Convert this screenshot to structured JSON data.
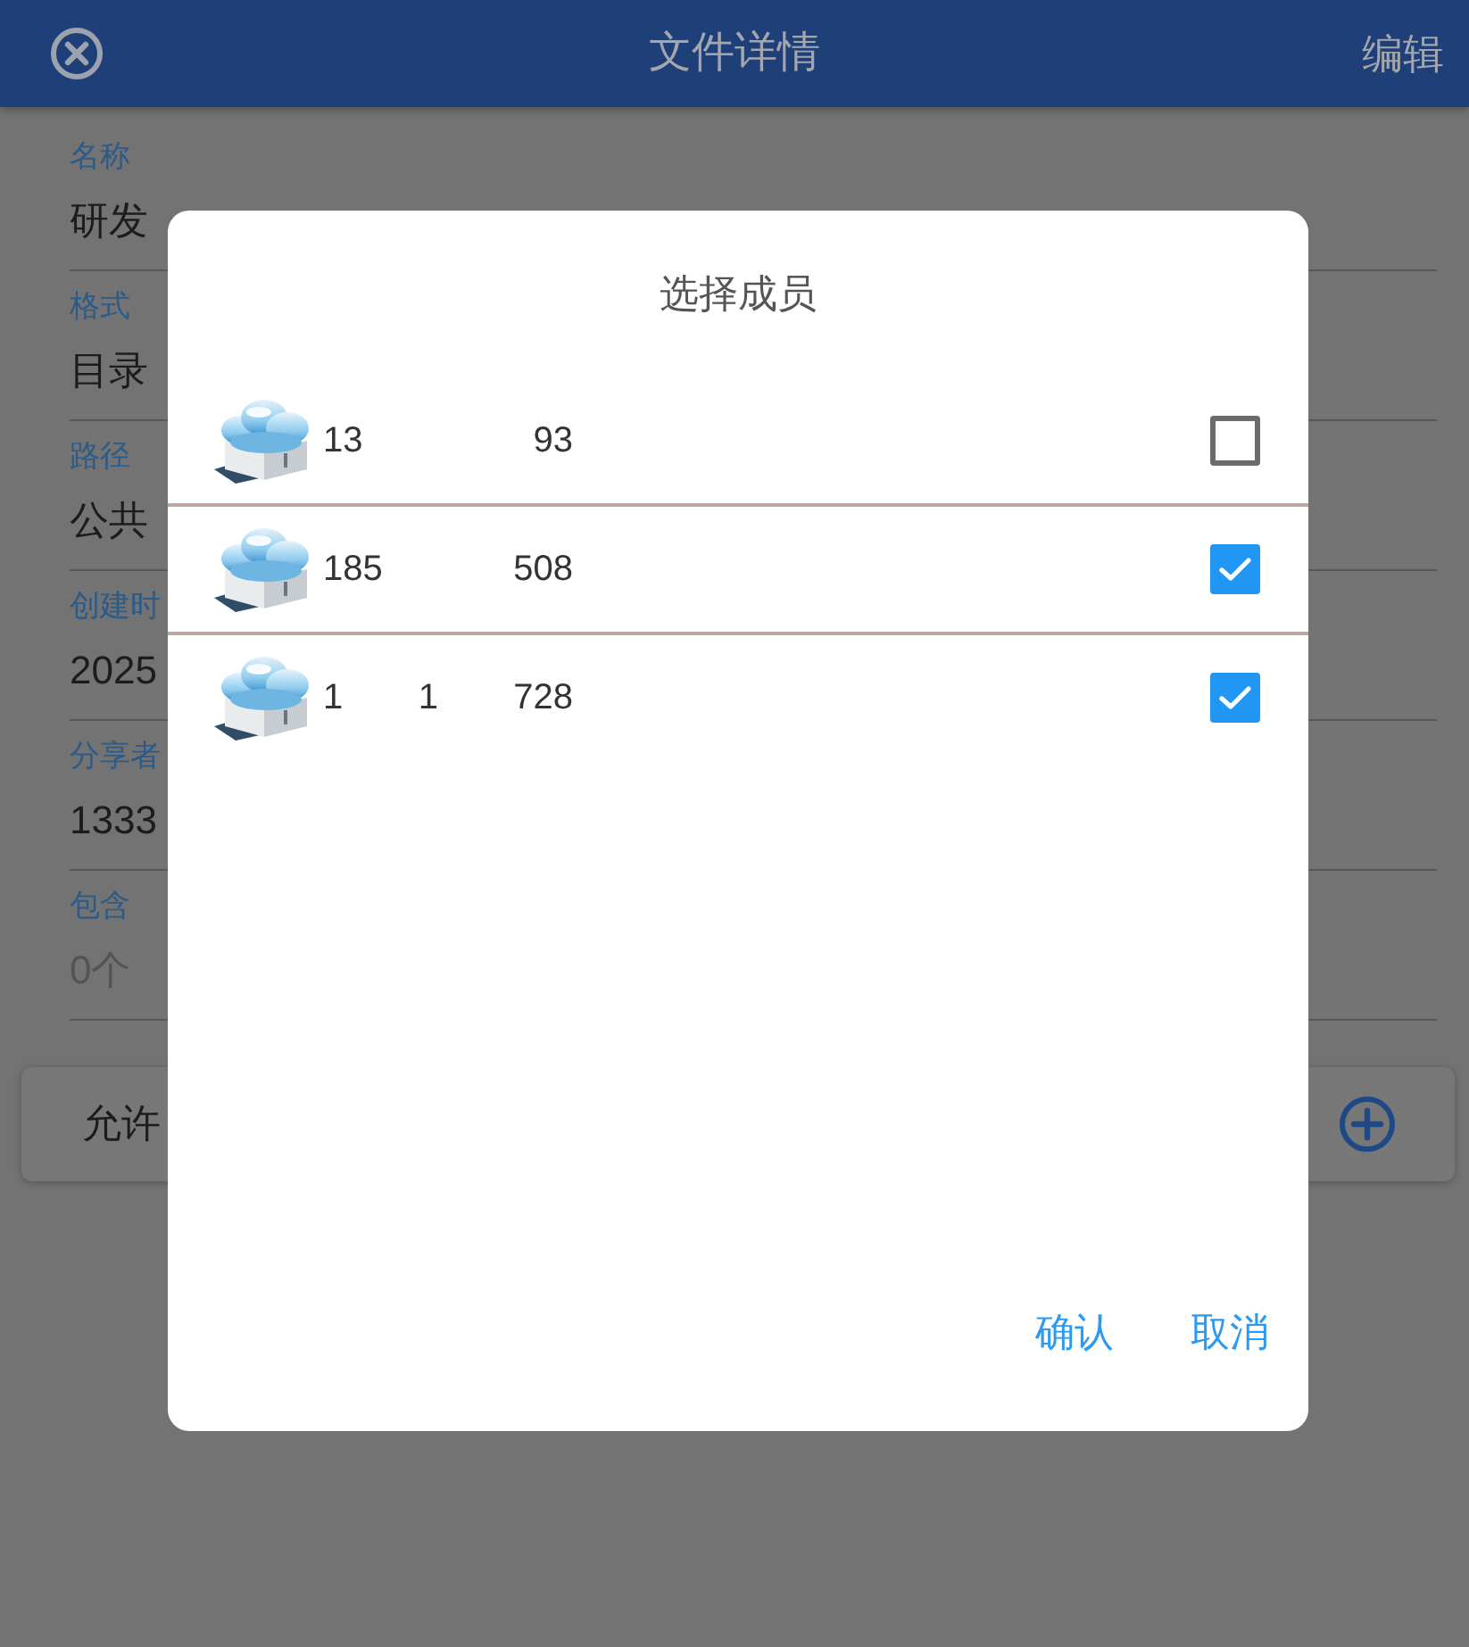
{
  "header": {
    "title": "文件详情",
    "action": "编辑"
  },
  "fields": [
    {
      "label": "名称",
      "value": "研发",
      "muted": false
    },
    {
      "label": "格式",
      "value": "目录",
      "muted": false
    },
    {
      "label": "路径",
      "value": "公共",
      "muted": false
    },
    {
      "label": "创建时",
      "value": "2025",
      "muted": false
    },
    {
      "label": "分享者",
      "value": "1333",
      "muted": false
    },
    {
      "label": "包含",
      "value": "0个",
      "muted": true
    }
  ],
  "permission_card": {
    "label": "允许"
  },
  "dialog": {
    "title": "选择成员",
    "members": [
      {
        "name_parts": [
          "13",
          "93"
        ],
        "checked": false
      },
      {
        "name_parts": [
          "185",
          "508"
        ],
        "checked": true
      },
      {
        "name_parts": [
          "1",
          "1",
          "728"
        ],
        "checked": true
      }
    ],
    "buttons": [
      "确认",
      "取消"
    ]
  }
}
